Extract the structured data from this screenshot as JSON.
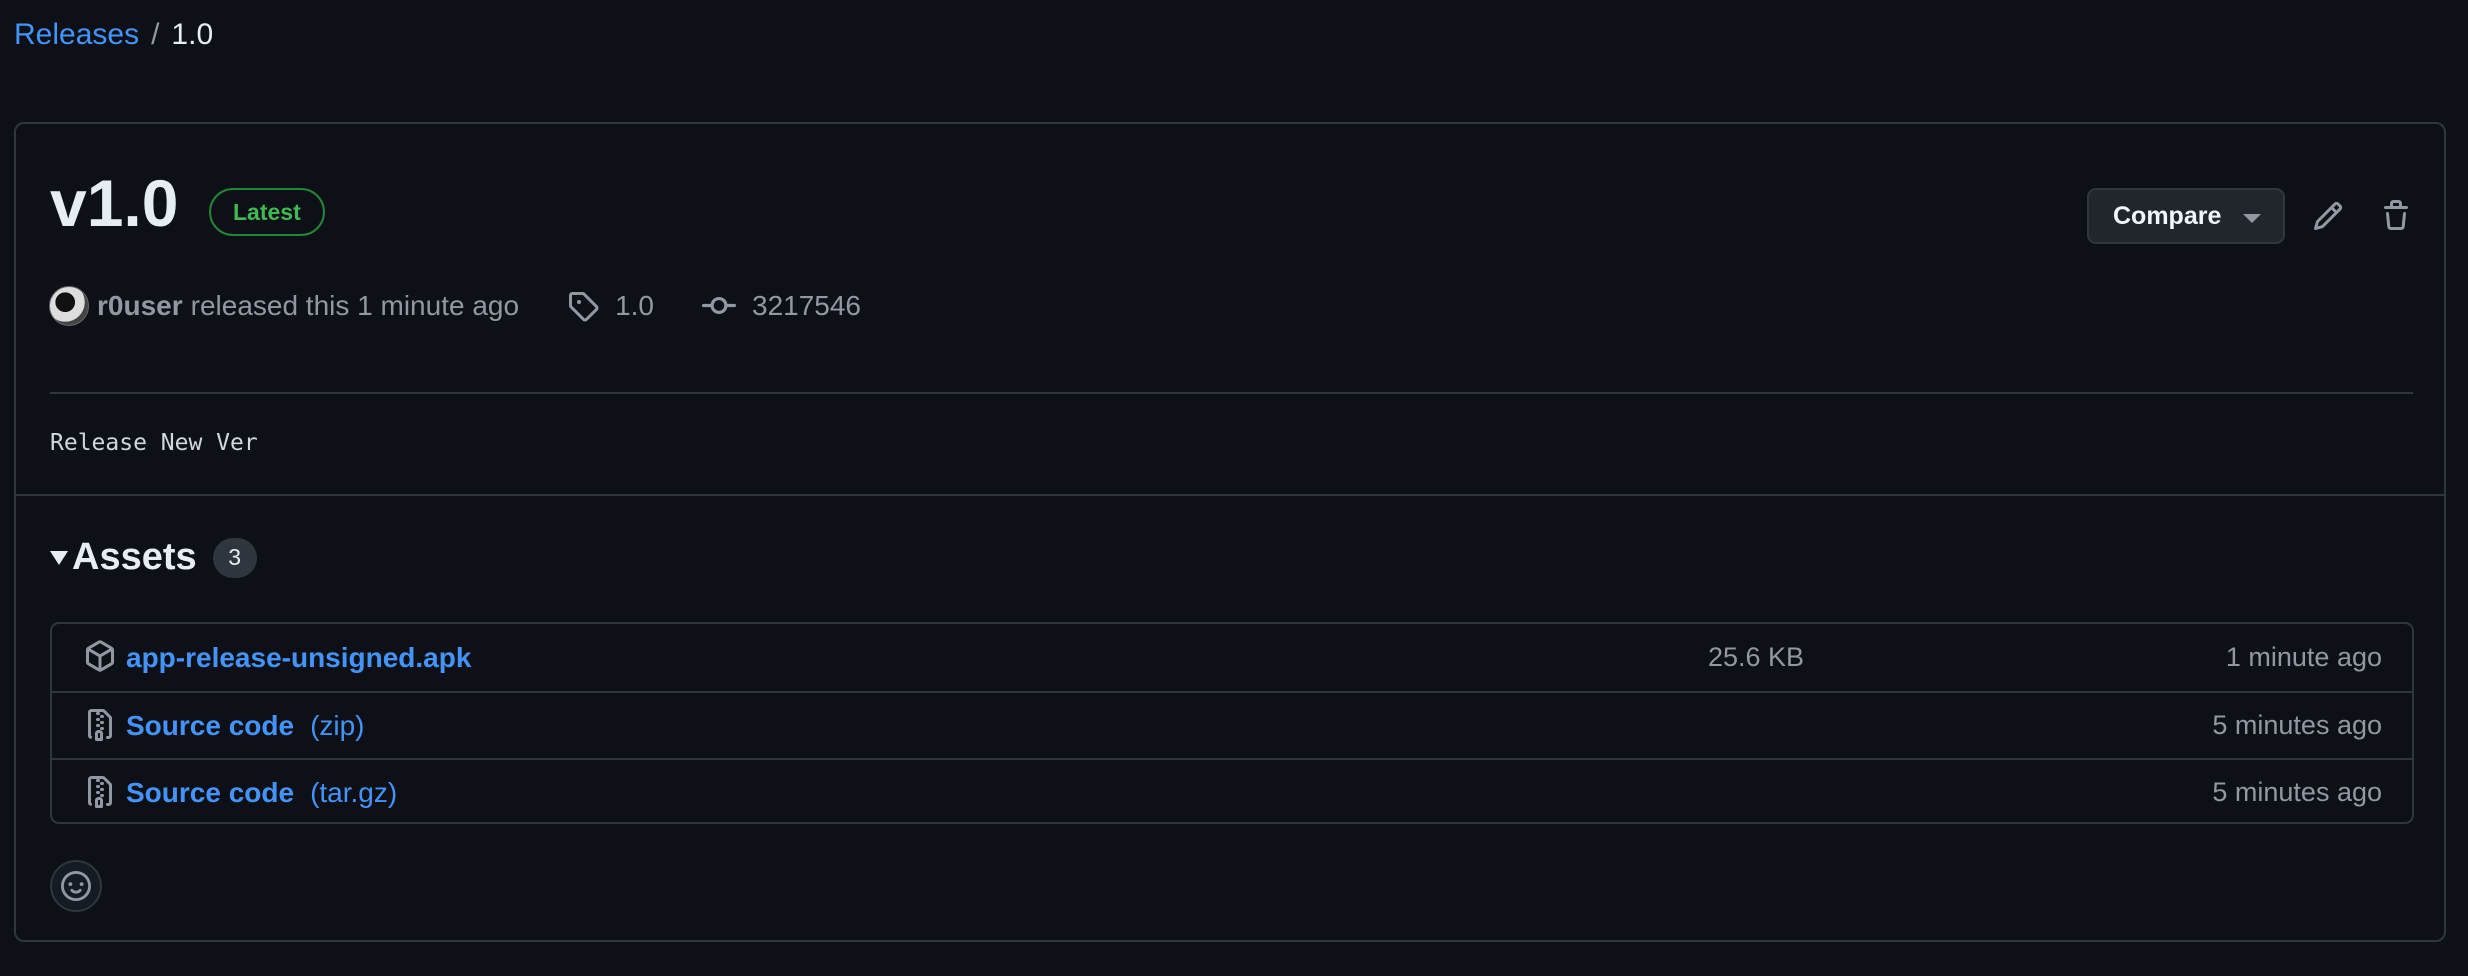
{
  "breadcrumb": {
    "parent": "Releases",
    "separator": "/",
    "current": "1.0"
  },
  "release": {
    "title": "v1.0",
    "badge": "Latest",
    "compare_label": "Compare",
    "author": "r0user",
    "released_text": "released this 1 minute ago",
    "tag": "1.0",
    "commit": "3217546",
    "notes": "Release New Ver"
  },
  "assets": {
    "label": "Assets",
    "count": "3",
    "rows": [
      {
        "name": "app-release-unsigned.apk",
        "ext": "",
        "size": "25.6 KB",
        "time": "1 minute ago",
        "icon": "package-icon"
      },
      {
        "name": "Source code",
        "ext": "(zip)",
        "size": "",
        "time": "5 minutes ago",
        "icon": "file-zip-icon"
      },
      {
        "name": "Source code",
        "ext": "(tar.gz)",
        "size": "",
        "time": "5 minutes ago",
        "icon": "file-zip-icon"
      }
    ]
  },
  "colors": {
    "background": "#0d1117",
    "link": "#4493f8",
    "success": "#3fb950",
    "border": "#30363d",
    "muted": "#9198a1"
  }
}
